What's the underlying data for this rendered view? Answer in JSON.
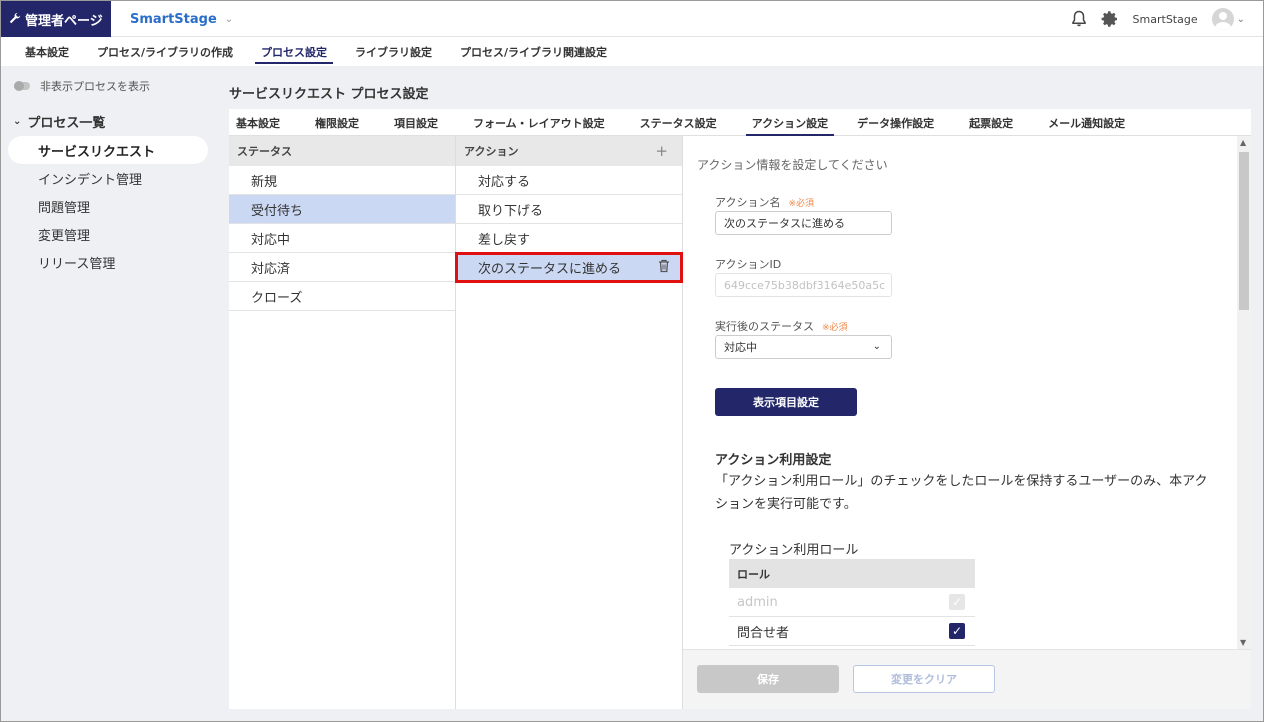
{
  "topbar": {
    "admin_label": "管理者ページ",
    "app_name": "SmartStage",
    "user_name": "SmartStage"
  },
  "main_tabs": [
    "基本設定",
    "プロセス/ライブラリの作成",
    "プロセス設定",
    "ライブラリ設定",
    "プロセス/ライブラリ関連設定"
  ],
  "sidebar": {
    "toggle_label": "非表示プロセスを表示",
    "section_title": "プロセス一覧",
    "items": [
      "サービスリクエスト",
      "インシデント管理",
      "問題管理",
      "変更管理",
      "リリース管理"
    ]
  },
  "page_title": "サービスリクエスト プロセス設定",
  "sub_tabs": [
    "基本設定",
    "権限設定",
    "項目設定",
    "フォーム・レイアウト設定",
    "ステータス設定",
    "アクション設定",
    "データ操作設定",
    "起票設定",
    "メール通知設定"
  ],
  "status_column": {
    "header": "ステータス",
    "items": [
      "新規",
      "受付待ち",
      "対応中",
      "対応済",
      "クローズ"
    ]
  },
  "action_column": {
    "header": "アクション",
    "items": [
      "対応する",
      "取り下げる",
      "差し戻す",
      "次のステータスに進める"
    ]
  },
  "detail": {
    "intro": "アクション情報を設定してください",
    "required_mark": "※必須",
    "action_name_label": "アクション名",
    "action_name_value": "次のステータスに進める",
    "action_id_label": "アクションID",
    "action_id_value": "649cce75b38dbf3164e50a5c",
    "next_status_label": "実行後のステータス",
    "next_status_value": "対応中",
    "display_items_button": "表示項目設定",
    "section_title": "アクション利用設定",
    "section_desc": "「アクション利用ロール」のチェックをしたロールを保持するユーザーのみ、本アクションを実行可能です。",
    "role_label": "アクション利用ロール",
    "role_header": "ロール",
    "roles": [
      {
        "name": "admin",
        "checked": true,
        "disabled": true
      },
      {
        "name": "問合せ者",
        "checked": true,
        "disabled": false
      }
    ],
    "save_button": "保存",
    "clear_button": "変更をクリア"
  }
}
